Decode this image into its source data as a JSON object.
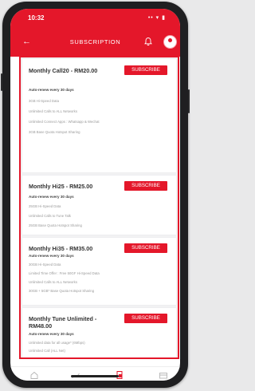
{
  "status": {
    "time": "10:32",
    "icons": "•• ▾ ▮"
  },
  "header": {
    "title": "SUBSCRIPTION",
    "back_icon": "back-arrow-icon",
    "bell_icon": "bell-icon",
    "avatar_icon": "avatar-icon"
  },
  "colors": {
    "accent": "#e4172a"
  },
  "plans": [
    {
      "title": "Monthly Call20 - RM20.00",
      "button": "SUBSCRIBE",
      "auto": "Auto-renew every 30 days",
      "features": [
        "3GB Hi-Speed Data",
        "Unlimited Calls to ALL Networks",
        "Unlimited Connect Apps : Whatsapp & Wechat",
        "3GB Base Quota Hotspot Sharing"
      ]
    },
    {
      "title": "Monthly Hi25 - RM25.00",
      "button": "SUBSCRIBE",
      "auto": "Auto-renew every 30 days",
      "features": [
        "25GB Hi-Speed Data",
        "Unlimited Calls to Tune Talk",
        "25GB Base Quota Hotspot Sharing"
      ]
    },
    {
      "title": "Monthly Hi35 - RM35.00",
      "button": "SUBSCRIBE",
      "auto": "Auto-renew every 30 days",
      "features": [
        "30GB Hi-Speed Data",
        "Limited Time Offer : Free 50GF Hi-Speed Data",
        "Unlimited Calls to ALL Networks",
        "30GB + 5GB* Base Quota Hotspot Sharing"
      ]
    },
    {
      "title": "Monthly Tune Unlimited - RM48.00",
      "button": "SUBSCRIBE",
      "auto": "Auto-renew every 30 days",
      "features": [
        "Unlimited data for all usage* (6Mbps)",
        "Unlimited Call (ALL Net)"
      ]
    }
  ],
  "nav": {
    "items": [
      "home-icon",
      "stats-icon",
      "plans-icon",
      "wallet-icon"
    ]
  }
}
